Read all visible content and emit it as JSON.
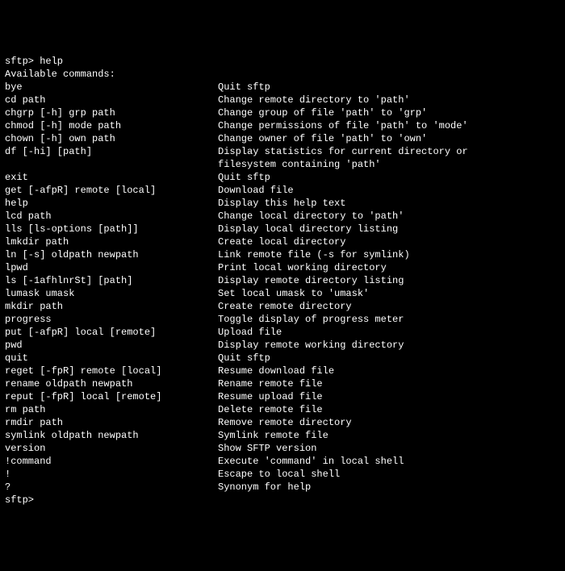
{
  "prompt_first": "sftp> help",
  "header": "Available commands:",
  "commands": [
    {
      "cmd": "bye",
      "desc": "Quit sftp"
    },
    {
      "cmd": "cd path",
      "desc": "Change remote directory to 'path'"
    },
    {
      "cmd": "chgrp [-h] grp path",
      "desc": "Change group of file 'path' to 'grp'"
    },
    {
      "cmd": "chmod [-h] mode path",
      "desc": "Change permissions of file 'path' to 'mode'"
    },
    {
      "cmd": "chown [-h] own path",
      "desc": "Change owner of file 'path' to 'own'"
    },
    {
      "cmd": "df [-hi] [path]",
      "desc": "Display statistics for current directory or"
    },
    {
      "cmd": "",
      "desc": "filesystem containing 'path'"
    },
    {
      "cmd": "exit",
      "desc": "Quit sftp"
    },
    {
      "cmd": "get [-afpR] remote [local]",
      "desc": "Download file"
    },
    {
      "cmd": "help",
      "desc": "Display this help text"
    },
    {
      "cmd": "lcd path",
      "desc": "Change local directory to 'path'"
    },
    {
      "cmd": "lls [ls-options [path]]",
      "desc": "Display local directory listing"
    },
    {
      "cmd": "lmkdir path",
      "desc": "Create local directory"
    },
    {
      "cmd": "ln [-s] oldpath newpath",
      "desc": "Link remote file (-s for symlink)"
    },
    {
      "cmd": "lpwd",
      "desc": "Print local working directory"
    },
    {
      "cmd": "ls [-1afhlnrSt] [path]",
      "desc": "Display remote directory listing"
    },
    {
      "cmd": "lumask umask",
      "desc": "Set local umask to 'umask'"
    },
    {
      "cmd": "mkdir path",
      "desc": "Create remote directory"
    },
    {
      "cmd": "progress",
      "desc": "Toggle display of progress meter"
    },
    {
      "cmd": "put [-afpR] local [remote]",
      "desc": "Upload file"
    },
    {
      "cmd": "pwd",
      "desc": "Display remote working directory"
    },
    {
      "cmd": "quit",
      "desc": "Quit sftp"
    },
    {
      "cmd": "reget [-fpR] remote [local]",
      "desc": "Resume download file"
    },
    {
      "cmd": "rename oldpath newpath",
      "desc": "Rename remote file"
    },
    {
      "cmd": "reput [-fpR] local [remote]",
      "desc": "Resume upload file"
    },
    {
      "cmd": "rm path",
      "desc": "Delete remote file"
    },
    {
      "cmd": "rmdir path",
      "desc": "Remove remote directory"
    },
    {
      "cmd": "symlink oldpath newpath",
      "desc": "Symlink remote file"
    },
    {
      "cmd": "version",
      "desc": "Show SFTP version"
    },
    {
      "cmd": "!command",
      "desc": "Execute 'command' in local shell"
    },
    {
      "cmd": "!",
      "desc": "Escape to local shell"
    },
    {
      "cmd": "?",
      "desc": "Synonym for help"
    }
  ],
  "prompt_last": "sftp>"
}
